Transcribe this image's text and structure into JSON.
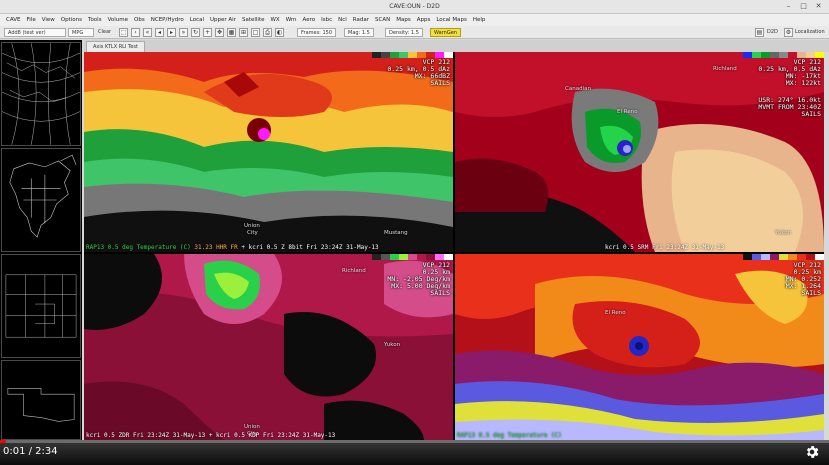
{
  "window": {
    "title": "CAVE:OUN - D2D"
  },
  "menu": [
    "CAVE",
    "File",
    "View",
    "Options",
    "Tools",
    "Volume",
    "Obs",
    "NCEP/Hydro",
    "Local",
    "Upper Air",
    "Satellite",
    "WX",
    "Wrn",
    "Aero",
    "Isbc",
    "Ncl",
    "Radar",
    "SCAN",
    "Maps",
    "Apps",
    "Local Maps",
    "Help"
  ],
  "toolbar": {
    "frame_select": "Add8 (test ver)",
    "map_select": "MPG",
    "clear_label": "Clear",
    "frames": "Frames: 150",
    "mag": "Mag: 1.5",
    "density": "Density: 1.5",
    "warngen_label": "WarnGen",
    "d2d_label": "D2D",
    "localization_label": "Localization"
  },
  "tab": {
    "label": "Axis KTLX RLI Test"
  },
  "panels": {
    "tl": {
      "vcp": "VCP 212",
      "elev": "0.25 km, 0.5 dAz",
      "mx": "MX: 66dBZ",
      "sails": "SAILS",
      "bottom_a": "RAP13 0.5 deg Temperature (C)",
      "bottom_b": "31.23",
      "bottom_c": "HHR FR",
      "bottom_d": "+ kcri 0.5  Z 8bit  Fri 23:24Z 31-May-13",
      "city_1": "Union",
      "city_2": "City",
      "city_3": "Mustang"
    },
    "tr": {
      "vcp": "VCP 212",
      "elev": "0.25 km, 0.5 dAz",
      "mn": "MN: -17kt",
      "mx": "MX: 122kt",
      "usr": "USR: 274° 16.0kt",
      "mvmt": "MVMT FROM 23:40Z",
      "sails": "SAILS",
      "bottom": "kcri 0.5  SRM  Fri 23:24Z 31-May-13",
      "city_1": "Richland",
      "city_2": "Canadian",
      "city_3": "El Reno",
      "city_4": "Yukon"
    },
    "bl": {
      "vcp": "VCP 212",
      "elev": "0.25 km",
      "mn": "MN: -2.05 Deg/km",
      "mx": "MX: 5.00 Deg/km",
      "sails": "SAILS",
      "bottom": "kcri 0.5  ZDR  Fri 23:24Z 31-May-13  + kcri 0.5  KDP  Fri 23:24Z 31-May-13",
      "city_1": "Richland",
      "city_2": "Yukon",
      "city_3": "Union",
      "city_4": "City"
    },
    "br": {
      "vcp": "VCP 212",
      "elev": "0.25 km",
      "mn": "MN: 0.252",
      "mx": "MX: 1.264",
      "sails": "SAILS",
      "bottom": "RAP13 0.5 deg Temperature (C)",
      "city_1": "El Reno"
    }
  },
  "video": {
    "time": "0:01 / 2:34",
    "progress": 0.007
  },
  "icons": {
    "gear": "settings-gear-icon",
    "minimize": "minimize-icon",
    "maximize": "maximize-icon",
    "close": "close-icon"
  }
}
